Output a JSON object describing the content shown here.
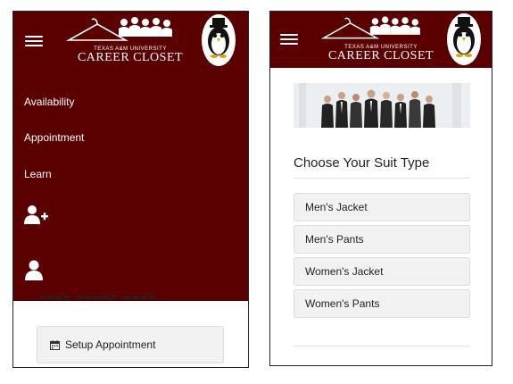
{
  "brand": {
    "university": "TEXAS A&M UNIVERSITY",
    "name": "CAREER CLOSET",
    "primary_color": "#5a0000"
  },
  "left_screen": {
    "menu_items": [
      {
        "label": "Availability"
      },
      {
        "label": "Appointment"
      },
      {
        "label": "Learn"
      }
    ],
    "menu_icons": [
      "add-user-icon",
      "user-icon"
    ],
    "setup_button": {
      "label": "Setup Appointment",
      "icon": "calendar-icon"
    }
  },
  "right_screen": {
    "section_title": "Choose Your Suit Type",
    "suit_types": [
      {
        "label": "Men's Jacket"
      },
      {
        "label": "Men's Pants"
      },
      {
        "label": "Women's Jacket"
      },
      {
        "label": "Women's Pants"
      }
    ]
  }
}
